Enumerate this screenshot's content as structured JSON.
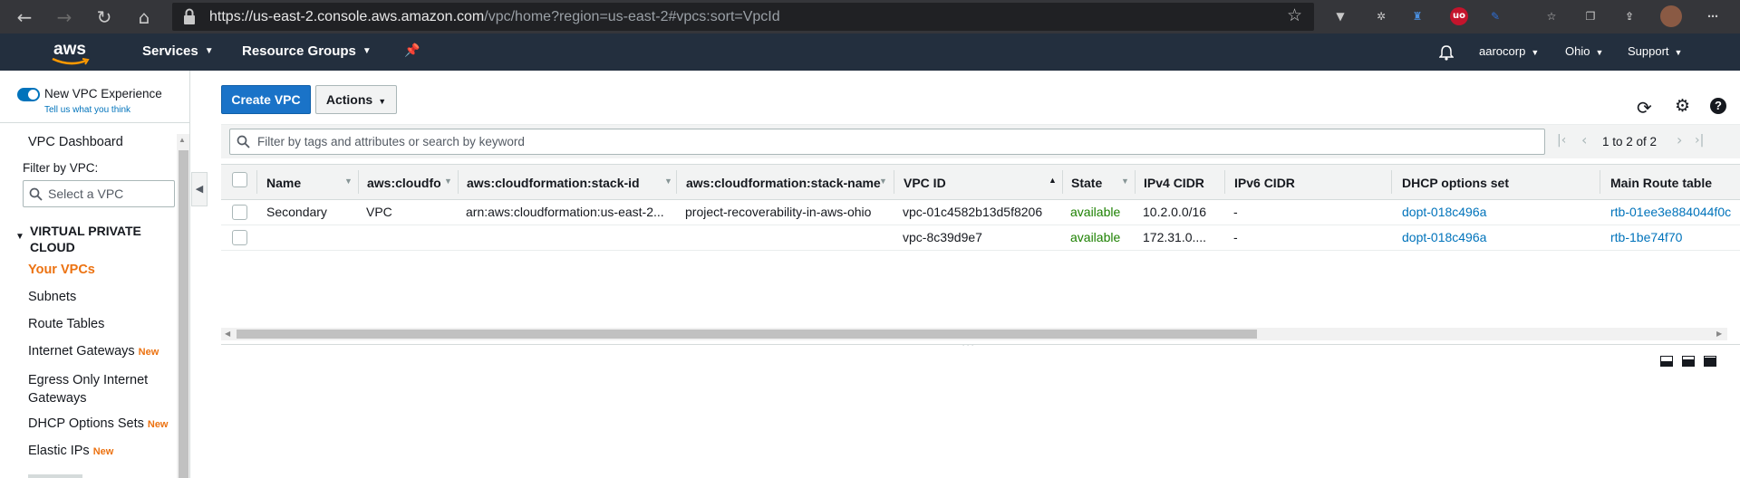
{
  "browser": {
    "url_main": "https://us-east-2.console.aws.amazon.com",
    "url_rest": "/vpc/home?region=us-east-2#vpcs:sort=VpcId"
  },
  "nav": {
    "logo": "aws",
    "services": "Services",
    "resource_groups": "Resource Groups",
    "account": "aarocorp",
    "region": "Ohio",
    "support": "Support"
  },
  "sidebar": {
    "toggle_label": "New VPC Experience",
    "toggle_link": "Tell us what you think",
    "dashboard": "VPC Dashboard",
    "filter_label": "Filter by VPC:",
    "filter_placeholder": "Select a VPC",
    "section": "VIRTUAL PRIVATE CLOUD",
    "items": [
      {
        "label": "Your VPCs",
        "new": ""
      },
      {
        "label": "Subnets",
        "new": ""
      },
      {
        "label": "Route Tables",
        "new": ""
      },
      {
        "label": "Internet Gateways",
        "new": "New"
      },
      {
        "label": "Egress Only Internet Gateways",
        "new": ""
      },
      {
        "label": "DHCP Options Sets",
        "new": "New"
      },
      {
        "label": "Elastic IPs",
        "new": "New"
      }
    ]
  },
  "toolbar": {
    "create": "Create VPC",
    "actions": "Actions",
    "search_placeholder": "Filter by tags and attributes or search by keyword",
    "pagination": "1 to 2 of 2"
  },
  "table": {
    "columns": [
      "Name",
      "aws:cloudfo",
      "aws:cloudformation:stack-id",
      "aws:cloudformation:stack-name",
      "VPC ID",
      "State",
      "IPv4 CIDR",
      "IPv6 CIDR",
      "DHCP options set",
      "Main Route table"
    ],
    "rows": [
      [
        "Secondary",
        "VPC",
        "arn:aws:cloudformation:us-east-2...",
        "project-recoverability-in-aws-ohio",
        "vpc-01c4582b13d5f8206",
        "available",
        "10.2.0.0/16",
        "-",
        "dopt-018c496a",
        "rtb-01ee3e884044f0c"
      ],
      [
        "",
        "",
        "",
        "",
        "vpc-8c39d9e7",
        "available",
        "172.31.0....",
        "-",
        "dopt-018c496a",
        "rtb-1be74f70"
      ]
    ]
  },
  "colors": {
    "nav_bg": "#232f3e",
    "primary": "#1a73c8",
    "orange": "#ec7211",
    "link": "#0073bb",
    "available": "#1d8102"
  }
}
